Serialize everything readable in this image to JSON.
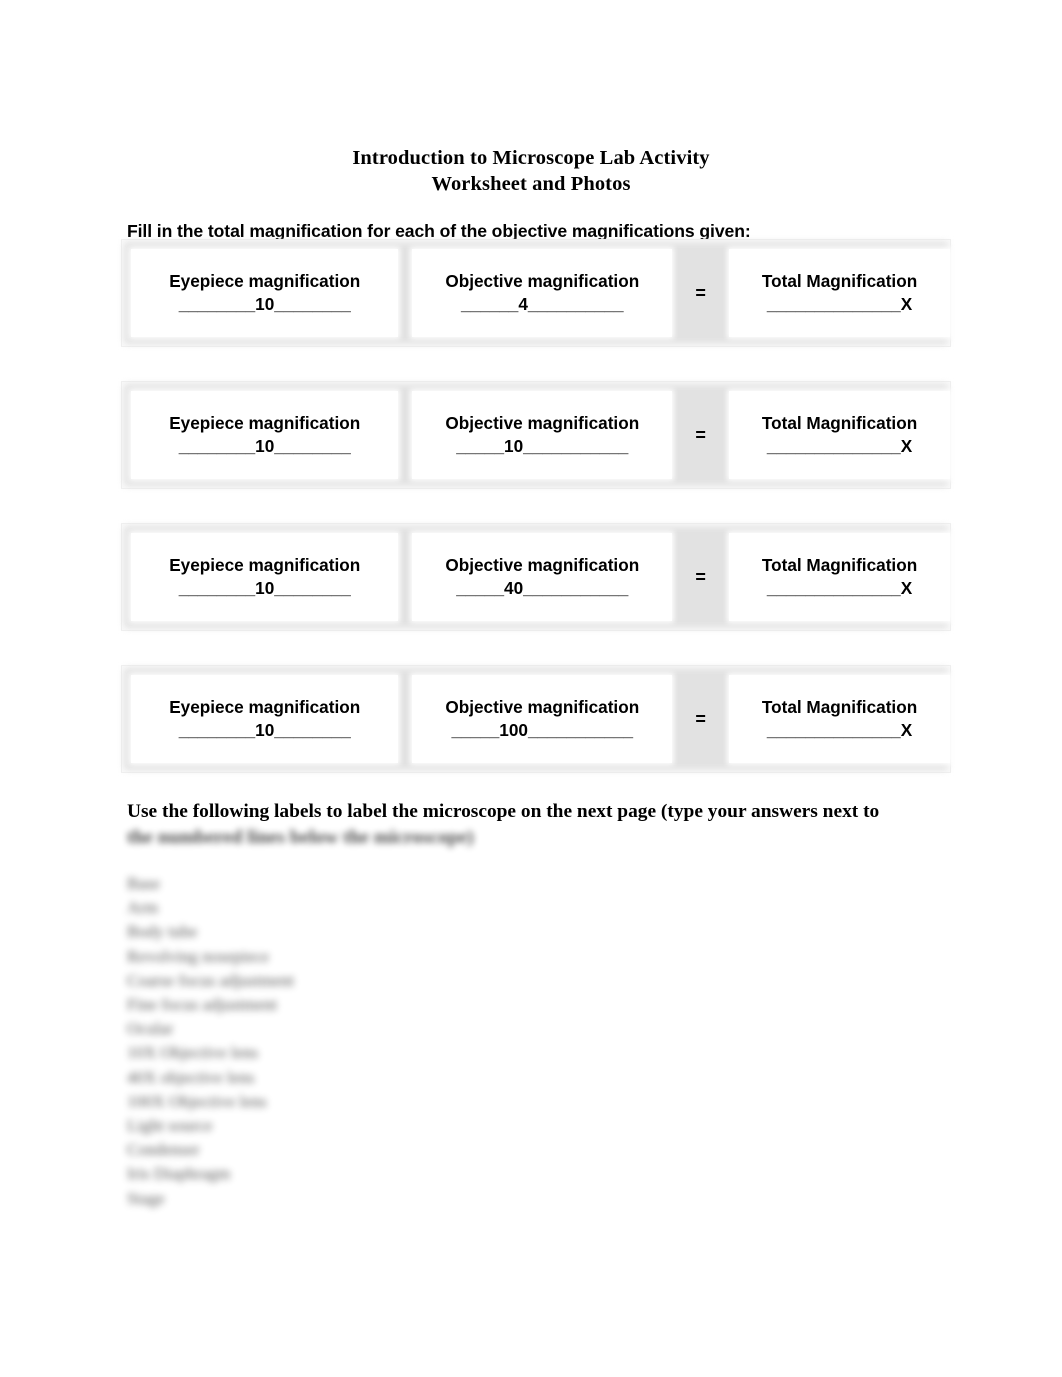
{
  "document": {
    "title_line1": "Introduction to Microscope Lab Activity",
    "title_line2": "Worksheet and Photos",
    "instruction": "Fill in the total magnification for each of the objective magnifications given:"
  },
  "magnification_table": {
    "equals_symbol": "=",
    "rows": [
      {
        "eyepiece_label": "Eyepiece magnification",
        "eyepiece_value": "________10________",
        "objective_label": "Objective magnification",
        "objective_value": "______4__________",
        "total_label": "Total Magnification",
        "total_value": "______________X"
      },
      {
        "eyepiece_label": "Eyepiece magnification",
        "eyepiece_value": "________10________",
        "objective_label": "Objective magnification",
        "objective_value": "_____10___________",
        "total_label": "Total Magnification",
        "total_value": "______________X"
      },
      {
        "eyepiece_label": "Eyepiece magnification",
        "eyepiece_value": "________10________",
        "objective_label": "Objective magnification",
        "objective_value": "_____40___________",
        "total_label": "Total Magnification",
        "total_value": "______________X"
      },
      {
        "eyepiece_label": "Eyepiece magnification",
        "eyepiece_value": "________10________",
        "objective_label": "Objective magnification",
        "objective_value": "_____100___________",
        "total_label": "Total Magnification",
        "total_value": "______________X"
      }
    ]
  },
  "labels_section": {
    "heading_line1": "Use the following labels to label the microscope on the next page (type your answers next to",
    "heading_line2": "the numbered lines below the microscope)",
    "items": [
      "Base",
      "Arm",
      "Body tube",
      "Revolving nosepiece",
      "Coarse focus adjustment",
      "Fine focus adjustment",
      "Ocular",
      "10X Objective lens",
      "40X objective lens",
      "100X Objective lens",
      "Light source",
      "Condenser",
      "Iris Diaphragm",
      "Stage"
    ]
  }
}
